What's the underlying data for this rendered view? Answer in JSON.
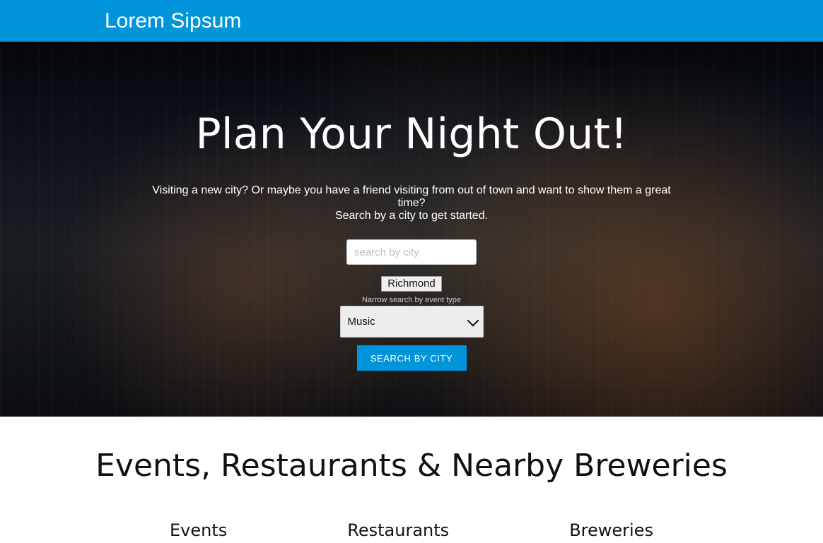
{
  "header": {
    "brand": "Lorem Sipsum"
  },
  "hero": {
    "title": "Plan Your Night Out!",
    "subtitle_line1": "Visiting a new city? Or maybe you have a friend visiting from out of town and want to show them a great time?",
    "subtitle_line2": "Search by a city to get started.",
    "search": {
      "placeholder": "search by city",
      "value": ""
    },
    "recent_city_button": "Richmond",
    "event_type_hint": "Narrow search by event type",
    "event_type_selected": "Music",
    "search_button": "SEARCH BY CITY"
  },
  "section": {
    "title": "Events, Restaurants & Nearby Breweries",
    "columns": [
      "Events",
      "Restaurants",
      "Breweries"
    ]
  },
  "colors": {
    "primary": "#0095da",
    "hero_overlay": "#0b0d11",
    "white": "#ffffff"
  }
}
